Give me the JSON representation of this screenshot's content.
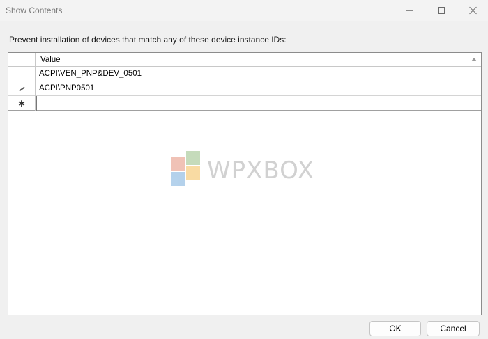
{
  "window": {
    "title": "Show Contents"
  },
  "prompt": "Prevent installation of devices that match any of these device instance IDs:",
  "grid": {
    "column_header": "Value",
    "rows": [
      {
        "marker": "",
        "value": "ACPI\\VEN_PNP&DEV_0501"
      },
      {
        "marker": "pencil-icon",
        "value": "ACPI\\PNP0501"
      },
      {
        "marker": "new-row-star-icon",
        "value": ""
      }
    ]
  },
  "watermark": {
    "text": "WPXBOX"
  },
  "buttons": {
    "ok": "OK",
    "cancel": "Cancel"
  }
}
